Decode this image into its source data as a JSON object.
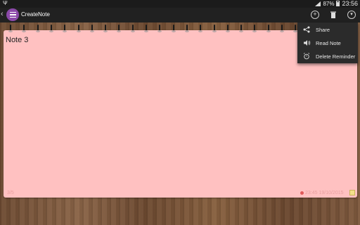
{
  "status_bar": {
    "battery": "87%",
    "time": "23:56"
  },
  "action_bar": {
    "back_icon": "chevron-left-icon",
    "app_icon": "notes-list-icon",
    "title": "CreateNote",
    "actions": [
      "add-icon",
      "trash-icon",
      "more-icon"
    ]
  },
  "note": {
    "title": "Note 3",
    "page_count": "3/5",
    "timestamp": "23:45 19/10/2015",
    "color": "#ffc1c1"
  },
  "menu": {
    "items": [
      {
        "label": "Share",
        "icon": "share-icon"
      },
      {
        "label": "Read Note",
        "icon": "speaker-icon"
      },
      {
        "label": "Delete Reminder",
        "icon": "alarm-icon"
      }
    ]
  },
  "colors": {
    "accent": "#8b49a9",
    "action_bar": "#212121",
    "note_bg": "#ffc1c1"
  }
}
